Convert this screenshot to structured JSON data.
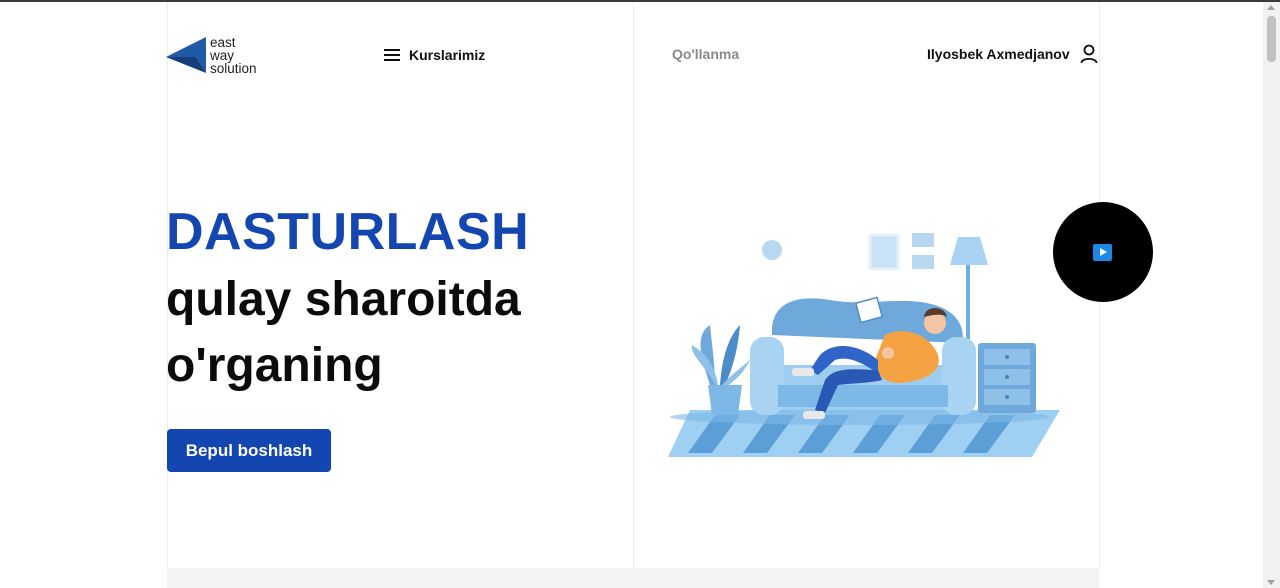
{
  "header": {
    "logo": {
      "lines": [
        "east",
        "way",
        "solution"
      ],
      "brand_color": "#1e5aa6"
    },
    "nav": {
      "courses_label": "Kurslarimiz",
      "courses_icon": "menu-icon",
      "guide_label": "Qo'llanma"
    },
    "user": {
      "name": "Ilyosbek Axmedjanov",
      "icon": "user-icon"
    }
  },
  "hero": {
    "headline_accent": "DASTURLASH",
    "headline_line2": "qulay sharoitda",
    "headline_line3": "o'rganing",
    "cta_label": "Bepul boshlash",
    "accent_color": "#1346b0"
  },
  "media": {
    "play_icon": "play-icon"
  }
}
